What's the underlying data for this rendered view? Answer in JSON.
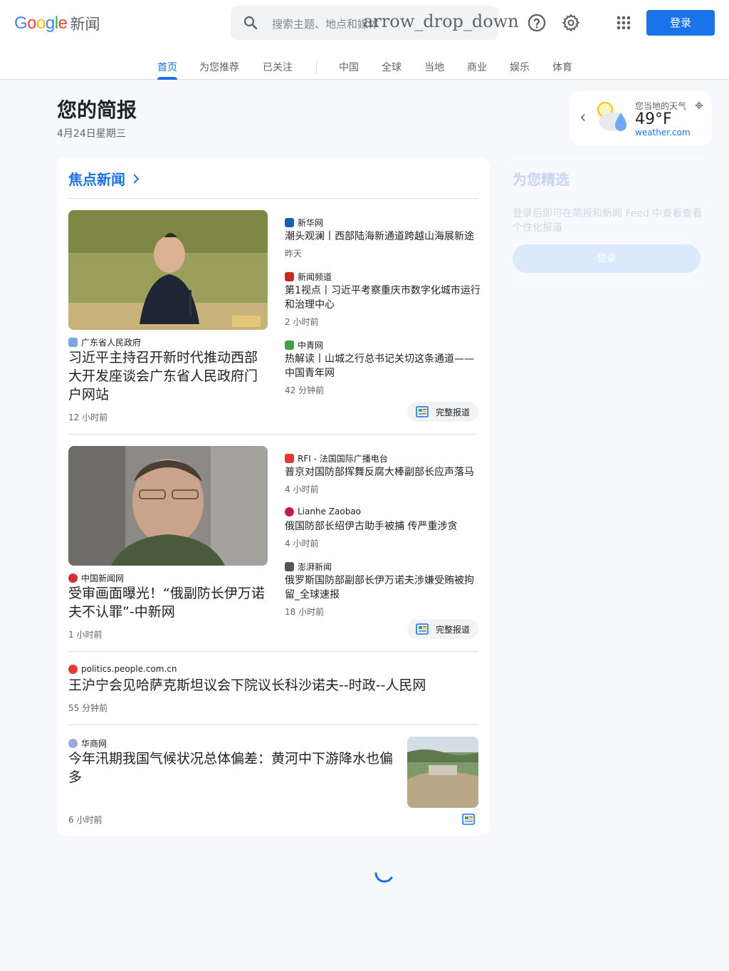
{
  "header": {
    "logo_text": "Google",
    "product_name": "新闻",
    "search_placeholder": "搜索主题、地点和媒体",
    "search_dropdown_glyph": "arrow_drop_down",
    "login_label": "登录"
  },
  "tabs": [
    {
      "label": "首页",
      "active": true
    },
    {
      "label": "为您推荐"
    },
    {
      "label": "已关注"
    },
    {
      "label": "中国"
    },
    {
      "label": "全球"
    },
    {
      "label": "当地"
    },
    {
      "label": "商业"
    },
    {
      "label": "娱乐"
    },
    {
      "label": "体育"
    }
  ],
  "briefing": {
    "title": "您的简报",
    "date": "4月24日星期三"
  },
  "weather": {
    "label": "您当地的天气",
    "temp": "49°F",
    "source": "weather.com"
  },
  "top_stories": {
    "title": "焦点新闻",
    "full_coverage_label": "完整报道",
    "clusters": [
      {
        "main": {
          "source": "广东省人民政府",
          "headline": "习近平主持召开新时代推动西部大开发座谈会广东省人民政府门户网站",
          "time": "12 小时前"
        },
        "related": [
          {
            "source": "新华网",
            "headline": "潮头观澜丨西部陆海新通道跨越山海展新途",
            "time": "昨天"
          },
          {
            "source": "新闻频道",
            "headline": "第1视点丨习近平考察重庆市数字化城市运行和治理中心",
            "time": "2 小时前"
          },
          {
            "source": "中青网",
            "headline": "热解读丨山城之行总书记关切这条通道——中国青年网",
            "time": "42 分钟前"
          }
        ]
      },
      {
        "main": {
          "source": "中国新闻网",
          "headline": "受审画面曝光！“俄副防长伊万诺夫不认罪”-中新网",
          "time": "1 小时前"
        },
        "related": [
          {
            "source": "RFI - 法国国际广播电台",
            "headline": "普京对国防部挥舞反腐大棒副部长应声落马",
            "time": "4 小时前"
          },
          {
            "source": "Lianhe Zaobao",
            "headline": "俄国防部长绍伊古助手被捕 传严重涉贪",
            "time": "4 小时前"
          },
          {
            "source": "澎湃新闻",
            "headline": "俄罗斯国防部副部长伊万诺夫涉嫌受贿被拘留_全球速报",
            "time": "18 小时前"
          }
        ]
      }
    ],
    "single_story": {
      "source": "politics.people.com.cn",
      "headline": "王沪宁会见哈萨克斯坦议会下院议长科沙诺夫--时政--人民网",
      "time": "55 分钟前"
    },
    "image_story": {
      "source": "华商网",
      "headline": "今年汛期我国气候状况总体偏差：黄河中下游降水也偏多",
      "time": "6 小时前"
    }
  },
  "picks": {
    "title": "为您精选",
    "text": "登录后即可在简报和新闻 Feed 中查看查看个性化报道",
    "login_label": "登录"
  },
  "colors": {
    "accent": "#1a73e8",
    "background": "#f6f8fc"
  }
}
